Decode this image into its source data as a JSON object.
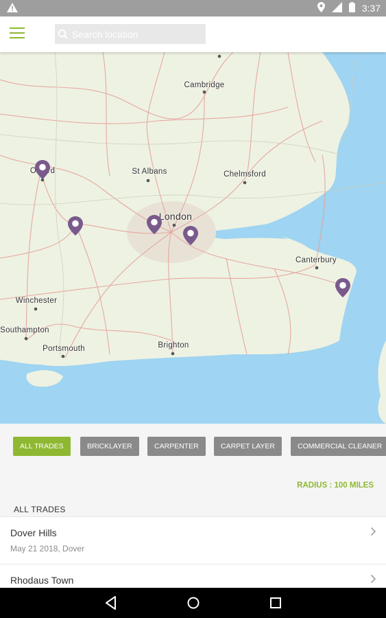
{
  "status_bar": {
    "time": "3:37",
    "icons": [
      "warning-icon",
      "location-icon",
      "signal-icon",
      "battery-icon"
    ]
  },
  "app_bar": {
    "menu_icon": "menu-icon",
    "search_placeholder": "Search location",
    "search_value": ""
  },
  "map": {
    "labels": [
      {
        "name": "Cambridge"
      },
      {
        "name": "St Albans"
      },
      {
        "name": "Chelmsford"
      },
      {
        "name": "Oxford"
      },
      {
        "name": "London"
      },
      {
        "name": "Canterbury"
      },
      {
        "name": "Winchester"
      },
      {
        "name": "Southampton"
      },
      {
        "name": "Portsmouth"
      },
      {
        "name": "Brighton"
      }
    ],
    "pin_color": "#7a5a8c",
    "sea_color": "#9fd4f2"
  },
  "filters": {
    "chips": [
      "ALL TRADES",
      "BRICKLAYER",
      "CARPENTER",
      "CARPET LAYER",
      "COMMERCIAL CLEANER"
    ],
    "active_index": 0
  },
  "radius_label": "RADIUS : 100 MILES",
  "list": {
    "section_title": "ALL TRADES",
    "items": [
      {
        "title": "Dover Hills",
        "subtitle": "May 21 2018, Dover"
      },
      {
        "title": "Rhodaus Town",
        "subtitle": ""
      }
    ]
  },
  "accent_color": "#8fb832"
}
